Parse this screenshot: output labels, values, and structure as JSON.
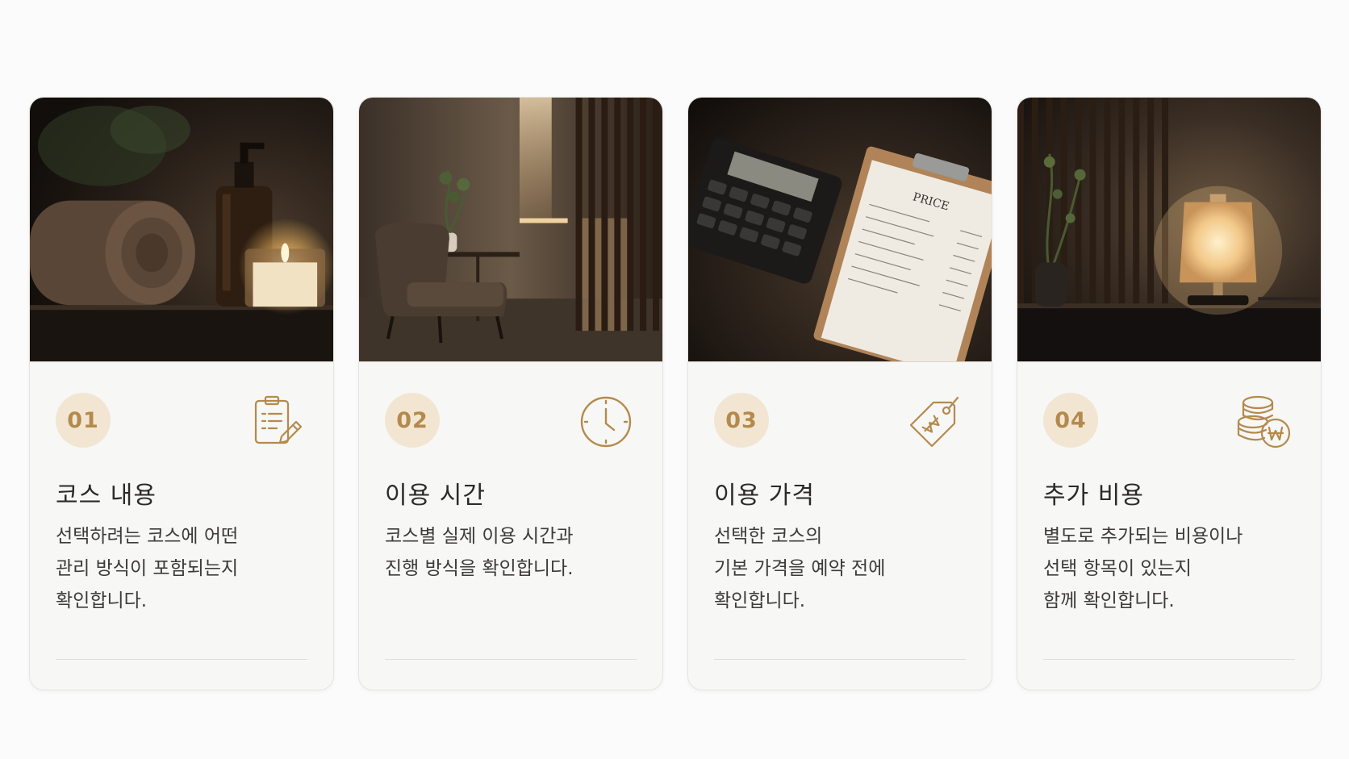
{
  "cards": [
    {
      "number": "01",
      "icon": "clipboard-edit-icon",
      "title": "코스 내용",
      "lines": [
        "선택하려는 코스에 어떤",
        "관리 방식이 포함되는지",
        "확인합니다."
      ]
    },
    {
      "number": "02",
      "icon": "clock-icon",
      "title": "이용 시간",
      "lines": [
        "코스별 실제 이용 시간과",
        "진행 방식을 확인합니다."
      ]
    },
    {
      "number": "03",
      "icon": "won-price-tag-icon",
      "title": "이용 가격",
      "lines": [
        "선택한 코스의",
        "기본 가격을 예약 전에",
        "확인합니다."
      ]
    },
    {
      "number": "04",
      "icon": "coins-won-icon",
      "title": "추가 비용",
      "lines": [
        "별도로 추가되는 비용이나",
        "선택 항목이 있는지",
        "함께 확인합니다."
      ]
    }
  ],
  "photo_text": {
    "price_sheet_heading": "PRICE"
  },
  "colors": {
    "accent": "#b48a4c",
    "badge_bg": "#f2e6d3",
    "card_bg": "#f7f7f6"
  }
}
